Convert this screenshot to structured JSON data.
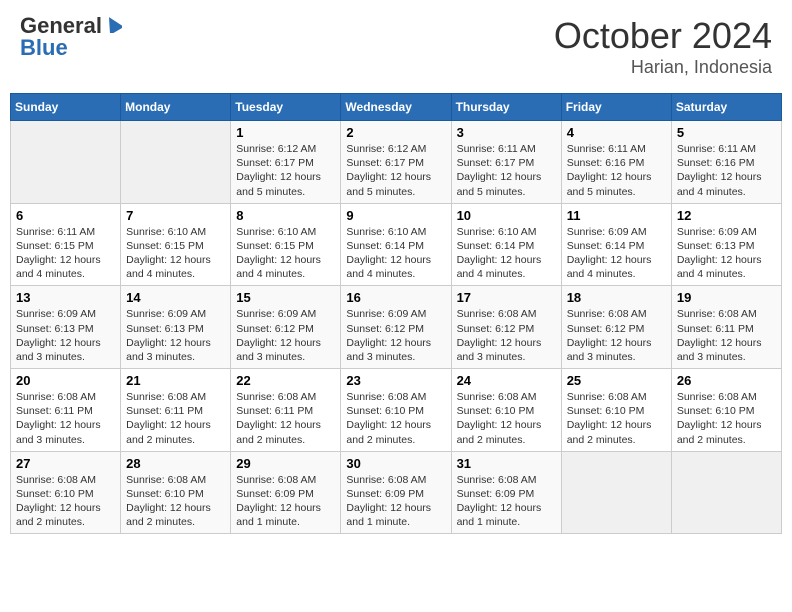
{
  "header": {
    "logo_general": "General",
    "logo_blue": "Blue",
    "month": "October 2024",
    "location": "Harian, Indonesia"
  },
  "weekdays": [
    "Sunday",
    "Monday",
    "Tuesday",
    "Wednesday",
    "Thursday",
    "Friday",
    "Saturday"
  ],
  "weeks": [
    [
      {
        "day": "",
        "info": ""
      },
      {
        "day": "",
        "info": ""
      },
      {
        "day": "1",
        "info": "Sunrise: 6:12 AM\nSunset: 6:17 PM\nDaylight: 12 hours\nand 5 minutes."
      },
      {
        "day": "2",
        "info": "Sunrise: 6:12 AM\nSunset: 6:17 PM\nDaylight: 12 hours\nand 5 minutes."
      },
      {
        "day": "3",
        "info": "Sunrise: 6:11 AM\nSunset: 6:17 PM\nDaylight: 12 hours\nand 5 minutes."
      },
      {
        "day": "4",
        "info": "Sunrise: 6:11 AM\nSunset: 6:16 PM\nDaylight: 12 hours\nand 5 minutes."
      },
      {
        "day": "5",
        "info": "Sunrise: 6:11 AM\nSunset: 6:16 PM\nDaylight: 12 hours\nand 4 minutes."
      }
    ],
    [
      {
        "day": "6",
        "info": "Sunrise: 6:11 AM\nSunset: 6:15 PM\nDaylight: 12 hours\nand 4 minutes."
      },
      {
        "day": "7",
        "info": "Sunrise: 6:10 AM\nSunset: 6:15 PM\nDaylight: 12 hours\nand 4 minutes."
      },
      {
        "day": "8",
        "info": "Sunrise: 6:10 AM\nSunset: 6:15 PM\nDaylight: 12 hours\nand 4 minutes."
      },
      {
        "day": "9",
        "info": "Sunrise: 6:10 AM\nSunset: 6:14 PM\nDaylight: 12 hours\nand 4 minutes."
      },
      {
        "day": "10",
        "info": "Sunrise: 6:10 AM\nSunset: 6:14 PM\nDaylight: 12 hours\nand 4 minutes."
      },
      {
        "day": "11",
        "info": "Sunrise: 6:09 AM\nSunset: 6:14 PM\nDaylight: 12 hours\nand 4 minutes."
      },
      {
        "day": "12",
        "info": "Sunrise: 6:09 AM\nSunset: 6:13 PM\nDaylight: 12 hours\nand 4 minutes."
      }
    ],
    [
      {
        "day": "13",
        "info": "Sunrise: 6:09 AM\nSunset: 6:13 PM\nDaylight: 12 hours\nand 3 minutes."
      },
      {
        "day": "14",
        "info": "Sunrise: 6:09 AM\nSunset: 6:13 PM\nDaylight: 12 hours\nand 3 minutes."
      },
      {
        "day": "15",
        "info": "Sunrise: 6:09 AM\nSunset: 6:12 PM\nDaylight: 12 hours\nand 3 minutes."
      },
      {
        "day": "16",
        "info": "Sunrise: 6:09 AM\nSunset: 6:12 PM\nDaylight: 12 hours\nand 3 minutes."
      },
      {
        "day": "17",
        "info": "Sunrise: 6:08 AM\nSunset: 6:12 PM\nDaylight: 12 hours\nand 3 minutes."
      },
      {
        "day": "18",
        "info": "Sunrise: 6:08 AM\nSunset: 6:12 PM\nDaylight: 12 hours\nand 3 minutes."
      },
      {
        "day": "19",
        "info": "Sunrise: 6:08 AM\nSunset: 6:11 PM\nDaylight: 12 hours\nand 3 minutes."
      }
    ],
    [
      {
        "day": "20",
        "info": "Sunrise: 6:08 AM\nSunset: 6:11 PM\nDaylight: 12 hours\nand 3 minutes."
      },
      {
        "day": "21",
        "info": "Sunrise: 6:08 AM\nSunset: 6:11 PM\nDaylight: 12 hours\nand 2 minutes."
      },
      {
        "day": "22",
        "info": "Sunrise: 6:08 AM\nSunset: 6:11 PM\nDaylight: 12 hours\nand 2 minutes."
      },
      {
        "day": "23",
        "info": "Sunrise: 6:08 AM\nSunset: 6:10 PM\nDaylight: 12 hours\nand 2 minutes."
      },
      {
        "day": "24",
        "info": "Sunrise: 6:08 AM\nSunset: 6:10 PM\nDaylight: 12 hours\nand 2 minutes."
      },
      {
        "day": "25",
        "info": "Sunrise: 6:08 AM\nSunset: 6:10 PM\nDaylight: 12 hours\nand 2 minutes."
      },
      {
        "day": "26",
        "info": "Sunrise: 6:08 AM\nSunset: 6:10 PM\nDaylight: 12 hours\nand 2 minutes."
      }
    ],
    [
      {
        "day": "27",
        "info": "Sunrise: 6:08 AM\nSunset: 6:10 PM\nDaylight: 12 hours\nand 2 minutes."
      },
      {
        "day": "28",
        "info": "Sunrise: 6:08 AM\nSunset: 6:10 PM\nDaylight: 12 hours\nand 2 minutes."
      },
      {
        "day": "29",
        "info": "Sunrise: 6:08 AM\nSunset: 6:09 PM\nDaylight: 12 hours\nand 1 minute."
      },
      {
        "day": "30",
        "info": "Sunrise: 6:08 AM\nSunset: 6:09 PM\nDaylight: 12 hours\nand 1 minute."
      },
      {
        "day": "31",
        "info": "Sunrise: 6:08 AM\nSunset: 6:09 PM\nDaylight: 12 hours\nand 1 minute."
      },
      {
        "day": "",
        "info": ""
      },
      {
        "day": "",
        "info": ""
      }
    ]
  ]
}
